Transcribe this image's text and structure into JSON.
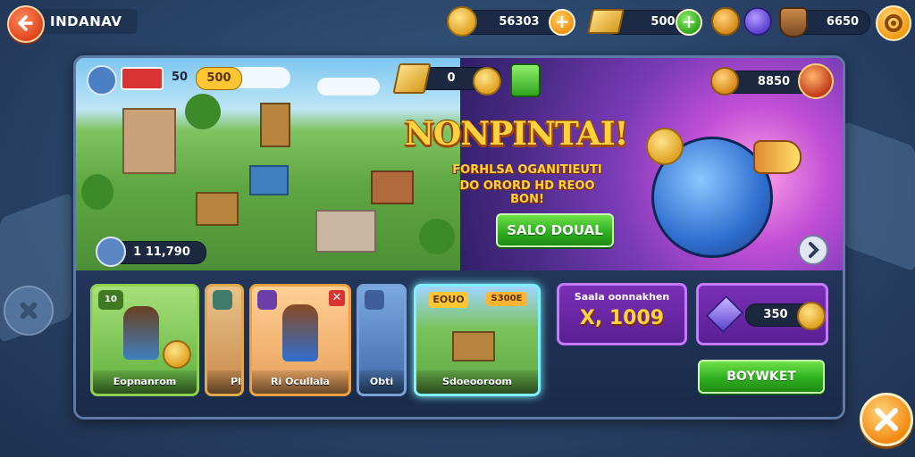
{
  "header": {
    "title": "INDANAV",
    "resources": [
      {
        "icon": "gold-coin-icon",
        "value": "56303"
      },
      {
        "icon": "gold-bars-icon",
        "value": "500"
      },
      {
        "icon": "shield-icon",
        "value": "6650"
      }
    ]
  },
  "map": {
    "badge_left": "50",
    "badge_right": "500",
    "population": "1 11,790"
  },
  "promo": {
    "currency_value": "0",
    "gem_value": "8850",
    "title": "NONPINTAI!",
    "subtitle_line1": "FORHLSA OGANITIEUTI",
    "subtitle_line2": "DO ORORD HD REOO BON!",
    "cta_label": "SALO DOUAL"
  },
  "cards": [
    {
      "label": "Eopnanrom",
      "badge": "10"
    },
    {
      "label": "Pl",
      "badge": ""
    },
    {
      "label": "Ri Ocullala",
      "badge": ""
    },
    {
      "label": "Obti",
      "badge": ""
    },
    {
      "label": "Sdoeooroom",
      "top_tag": "EOUO",
      "top_tag2": "S300E"
    }
  ],
  "offer": {
    "label": "Saala oonnakhen",
    "amount": "X, 1009"
  },
  "gem_offer": {
    "price": "350"
  },
  "buy_button": "BOYWKET",
  "colors": {
    "accent_orange": "#f29a12",
    "accent_green": "#2fb020",
    "accent_purple": "#7a2fb6",
    "title_gold": "#ffd23e"
  }
}
